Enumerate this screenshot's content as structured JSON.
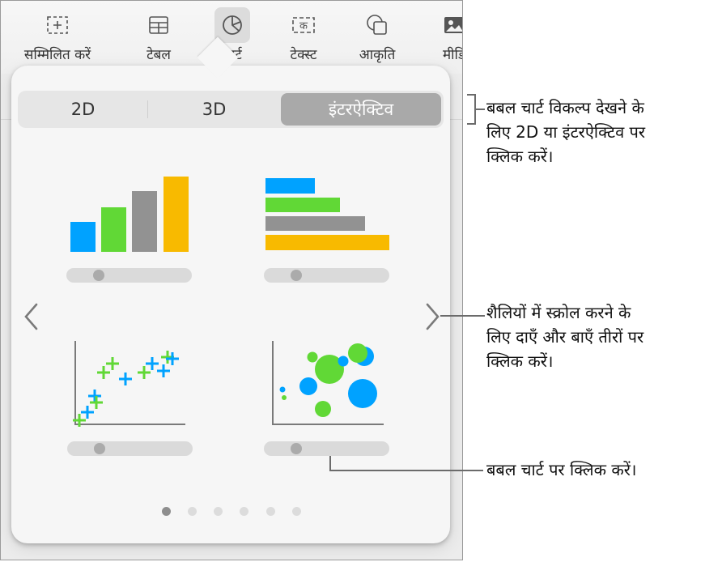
{
  "toolbar": {
    "items": [
      {
        "label": "सम्मिलित करें",
        "icon": "insert-icon",
        "active": false
      },
      {
        "label": "टेबल",
        "icon": "table-icon",
        "active": false
      },
      {
        "label": "चार्ट",
        "icon": "chart-icon",
        "active": true
      },
      {
        "label": "टेक्स्ट",
        "icon": "text-icon",
        "active": false
      },
      {
        "label": "आकृति",
        "icon": "shape-icon",
        "active": false
      },
      {
        "label": "मीडि",
        "icon": "media-icon",
        "active": false
      }
    ]
  },
  "popover": {
    "segments": [
      {
        "label": "2D",
        "active": false
      },
      {
        "label": "3D",
        "active": false
      },
      {
        "label": "इंटरऐक्टिव",
        "active": true
      }
    ],
    "chart_styles": [
      {
        "name": "column-chart",
        "type": "column",
        "slider_value": 0.25
      },
      {
        "name": "bar-chart",
        "type": "bar",
        "slider_value": 0.25
      },
      {
        "name": "scatter-chart",
        "type": "scatter",
        "slider_value": 0.25
      },
      {
        "name": "bubble-chart",
        "type": "bubble",
        "slider_value": 0.25
      }
    ],
    "page_indicator": {
      "total": 6,
      "current": 1
    },
    "colors": {
      "blue": "#00a2ff",
      "green": "#61d836",
      "gray": "#929292",
      "yellow": "#f8ba00"
    }
  },
  "callouts": [
    {
      "text": "बबल चार्ट विकल्प देखने के लिए 2D या इंटरऐक्टिव पर क्लिक करें।"
    },
    {
      "text": "शैलियों में स्क्रोल करने के लिए दाएँ और बाएँ तीरों पर क्लिक करें।"
    },
    {
      "text": "बबल चार्ट पर क्लिक करें।"
    }
  ],
  "callout_lines": [
    [
      "बबल चार्ट विकल्प देखने के",
      "लिए 2D या इंटरऐक्टिव पर",
      "क्लिक करें।"
    ],
    [
      "शैलियों में स्क्रोल करने के",
      "लिए दाएँ और बाएँ तीरों पर",
      "क्लिक करें।"
    ],
    [
      "बबल चार्ट पर क्लिक करें।"
    ]
  ]
}
